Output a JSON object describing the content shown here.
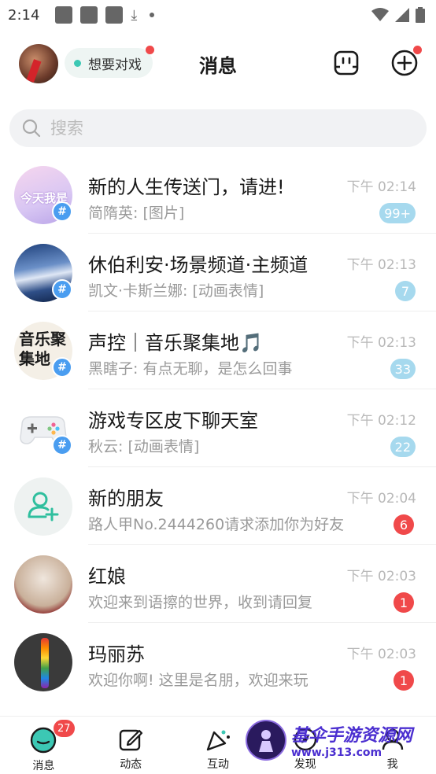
{
  "status_bar": {
    "time": "2:14"
  },
  "header": {
    "status_label": "想要对戏",
    "title": "消息"
  },
  "search": {
    "placeholder": "搜索"
  },
  "conversations": [
    {
      "name": "新的人生传送门，请进!",
      "time": "下午 02:14",
      "preview": "简隋英: [图片]",
      "badge": "99+",
      "badge_color": "#a6d9ee",
      "is_group": true,
      "avatar_text": "今天我是"
    },
    {
      "name": "休伯利安·场景频道·主频道",
      "time": "下午 02:13",
      "preview": "凯文·卡斯兰娜: [动画表情]",
      "badge": "7",
      "badge_color": "#a6d9ee",
      "is_group": true
    },
    {
      "name": "声控｜音乐聚集地🎵",
      "time": "下午 02:13",
      "preview": "黑瞎子: 有点无聊，是怎么回事",
      "badge": "33",
      "badge_color": "#a6d9ee",
      "is_group": true,
      "avatar_text": "音乐聚集地"
    },
    {
      "name": "游戏专区皮下聊天室",
      "time": "下午 02:12",
      "preview": "秋云: [动画表情]",
      "badge": "22",
      "badge_color": "#a6d9ee",
      "is_group": true
    },
    {
      "name": "新的朋友",
      "time": "下午 02:04",
      "preview": "路人甲No.2444260请求添加你为好友",
      "badge": "6",
      "badge_color": "#f0494a",
      "is_group": false
    },
    {
      "name": "红娘",
      "time": "下午 02:03",
      "preview": "欢迎来到语擦的世界，收到请回复",
      "badge": "1",
      "badge_color": "#f0494a",
      "is_group": false
    },
    {
      "name": "玛丽苏",
      "time": "下午 02:03",
      "preview": "欢迎你啊! 这里是名朋，欢迎来玩",
      "badge": "1",
      "badge_color": "#f0494a",
      "is_group": false
    }
  ],
  "tabbar": {
    "tabs": [
      {
        "label": "消息",
        "count": "27"
      },
      {
        "label": "动态"
      },
      {
        "label": "互动"
      },
      {
        "label": "发现"
      },
      {
        "label": "我"
      }
    ]
  },
  "watermark": {
    "title": "基伞手游资源网",
    "url": "www.j313.com"
  },
  "colors": {
    "accent": "#3cc8b4",
    "badge_red": "#f0494a",
    "badge_blue": "#a6d9ee",
    "group_tag": "#4a9df0"
  }
}
